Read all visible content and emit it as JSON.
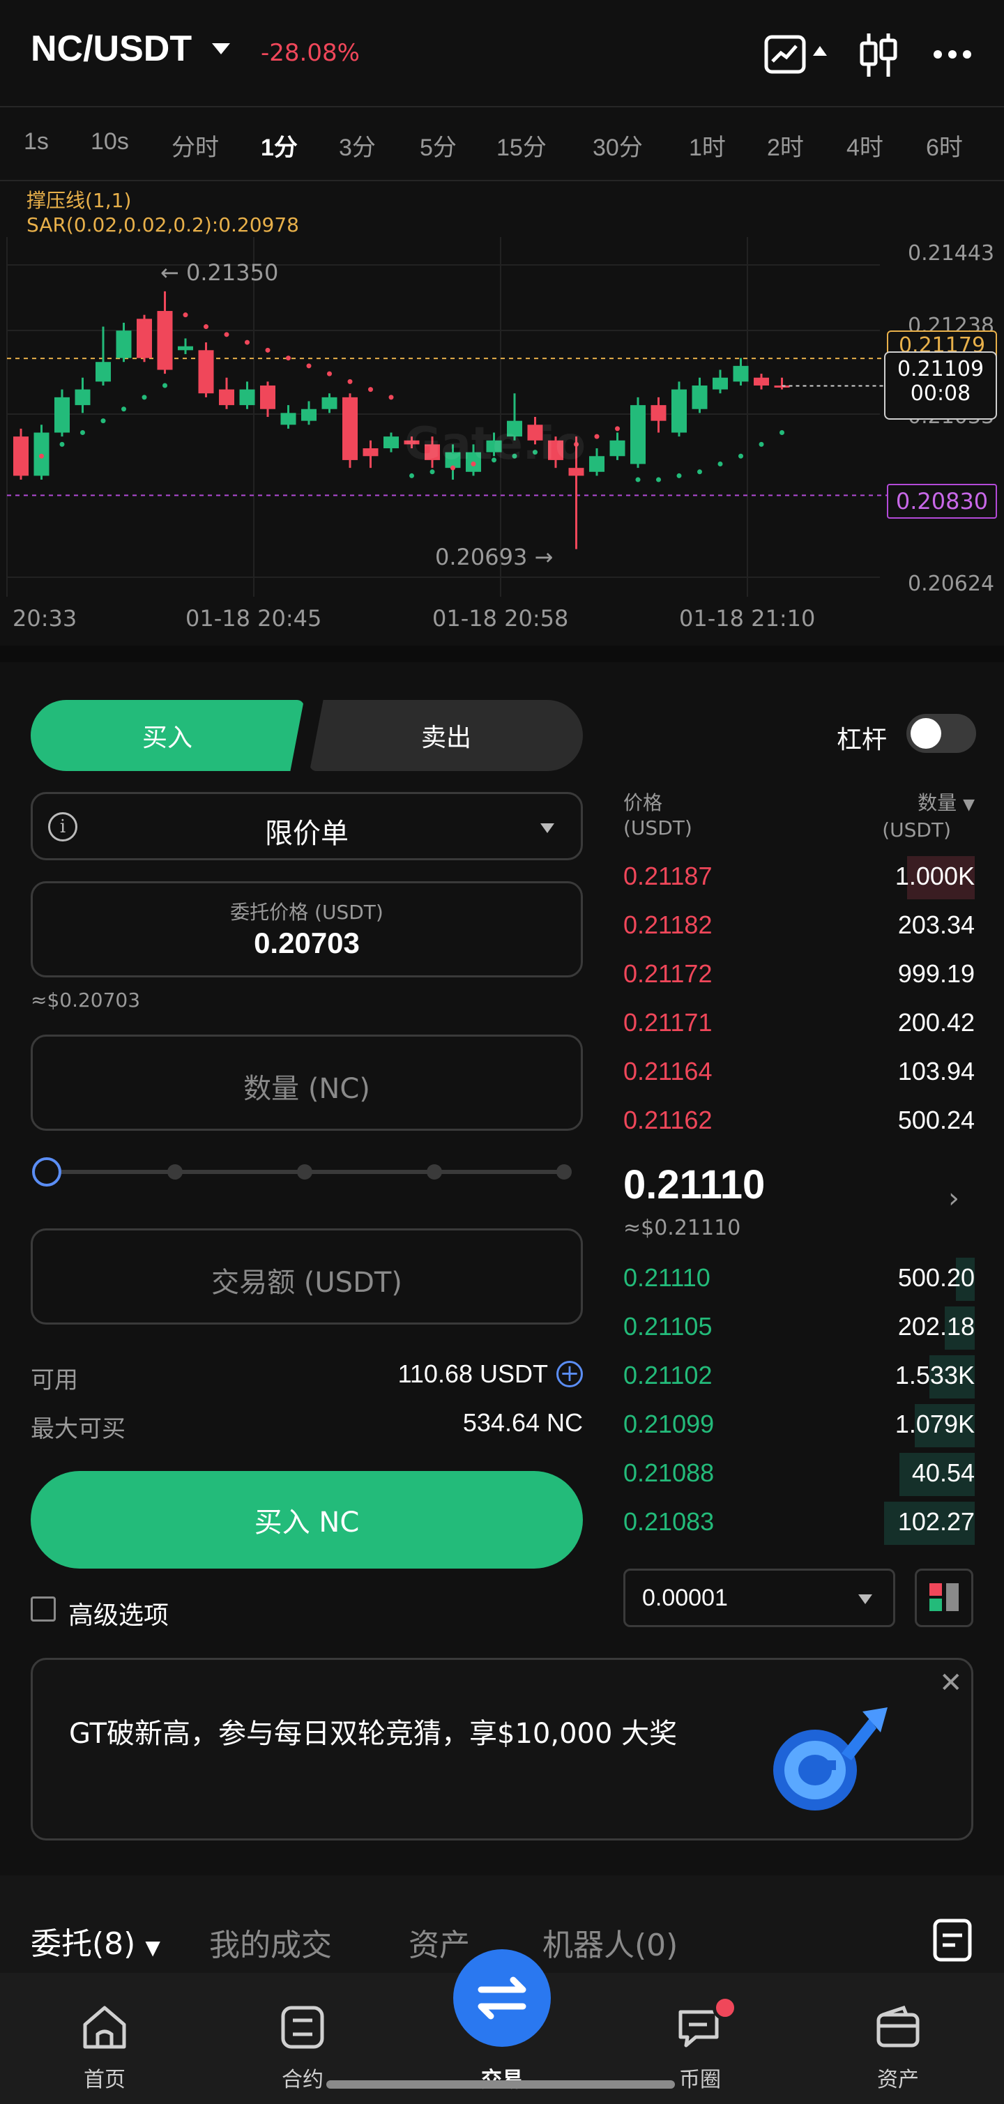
{
  "header": {
    "pair": "NC/USDT",
    "change": "-28.08%",
    "icons": [
      "chart-type-icon",
      "candlestick-settings-icon",
      "more-icon"
    ]
  },
  "timeframes": [
    "1s",
    "10s",
    "分时",
    "1分",
    "3分",
    "5分",
    "15分",
    "30分",
    "1时",
    "2时",
    "4时",
    "6时"
  ],
  "active_timeframe": "1分",
  "indicators": {
    "line1": "撑压线(1,1)",
    "line2": "SAR(0.02,0.02,0.2):0.20978"
  },
  "chart_data": {
    "type": "candlestick",
    "title": "",
    "y_ticks": [
      "0.21443",
      "0.21238",
      "0.21033",
      "0.20624"
    ],
    "y_range": [
      0.206,
      0.2146
    ],
    "x_ticks": [
      "20:33",
      "01-18 20:45",
      "01-18 20:58",
      "01-18 21:10"
    ],
    "high_label": "0.21350",
    "low_label": "0.20693",
    "resistance_label": "0.21179",
    "support_label": "0.20830",
    "resistance": 0.21179,
    "support": 0.2083,
    "last_price_label": "0.21109",
    "countdown": "00:08",
    "last_price": 0.21109,
    "watermark": "Gate.io",
    "candles": [
      {
        "o": 0.2098,
        "c": 0.2088,
        "h": 0.21,
        "l": 0.2087
      },
      {
        "o": 0.2088,
        "c": 0.2099,
        "h": 0.2101,
        "l": 0.2087
      },
      {
        "o": 0.2099,
        "c": 0.2108,
        "h": 0.211,
        "l": 0.2098
      },
      {
        "o": 0.2106,
        "c": 0.211,
        "h": 0.2113,
        "l": 0.2104
      },
      {
        "o": 0.2112,
        "c": 0.2117,
        "h": 0.2126,
        "l": 0.2111
      },
      {
        "o": 0.2118,
        "c": 0.2125,
        "h": 0.2127,
        "l": 0.2117
      },
      {
        "o": 0.2128,
        "c": 0.2118,
        "h": 0.2129,
        "l": 0.2117
      },
      {
        "o": 0.213,
        "c": 0.2115,
        "h": 0.2135,
        "l": 0.2114
      },
      {
        "o": 0.212,
        "c": 0.2121,
        "h": 0.2123,
        "l": 0.2119
      },
      {
        "o": 0.212,
        "c": 0.2109,
        "h": 0.2122,
        "l": 0.2108
      },
      {
        "o": 0.211,
        "c": 0.2106,
        "h": 0.2113,
        "l": 0.2105
      },
      {
        "o": 0.2106,
        "c": 0.211,
        "h": 0.2112,
        "l": 0.2105
      },
      {
        "o": 0.2111,
        "c": 0.2105,
        "h": 0.2112,
        "l": 0.2103
      },
      {
        "o": 0.2101,
        "c": 0.2104,
        "h": 0.2106,
        "l": 0.21
      },
      {
        "o": 0.2102,
        "c": 0.2105,
        "h": 0.2107,
        "l": 0.2101
      },
      {
        "o": 0.2105,
        "c": 0.2108,
        "h": 0.2109,
        "l": 0.2104
      },
      {
        "o": 0.2108,
        "c": 0.2092,
        "h": 0.2109,
        "l": 0.209
      },
      {
        "o": 0.2095,
        "c": 0.2093,
        "h": 0.2097,
        "l": 0.209
      },
      {
        "o": 0.2095,
        "c": 0.2098,
        "h": 0.2099,
        "l": 0.2094
      },
      {
        "o": 0.2097,
        "c": 0.2096,
        "h": 0.2098,
        "l": 0.2095
      },
      {
        "o": 0.2096,
        "c": 0.2092,
        "h": 0.2098,
        "l": 0.209
      },
      {
        "o": 0.209,
        "c": 0.2094,
        "h": 0.2096,
        "l": 0.2087
      },
      {
        "o": 0.2089,
        "c": 0.2094,
        "h": 0.2096,
        "l": 0.2088
      },
      {
        "o": 0.2094,
        "c": 0.2097,
        "h": 0.2099,
        "l": 0.2093
      },
      {
        "o": 0.2098,
        "c": 0.2102,
        "h": 0.2109,
        "l": 0.2097
      },
      {
        "o": 0.2101,
        "c": 0.2097,
        "h": 0.2103,
        "l": 0.2096
      },
      {
        "o": 0.2097,
        "c": 0.2092,
        "h": 0.2098,
        "l": 0.209
      },
      {
        "o": 0.209,
        "c": 0.2088,
        "h": 0.2098,
        "l": 0.20693
      },
      {
        "o": 0.2089,
        "c": 0.2093,
        "h": 0.2095,
        "l": 0.2088
      },
      {
        "o": 0.2093,
        "c": 0.2097,
        "h": 0.2099,
        "l": 0.2092
      },
      {
        "o": 0.2091,
        "c": 0.2106,
        "h": 0.2108,
        "l": 0.209
      },
      {
        "o": 0.2106,
        "c": 0.2102,
        "h": 0.2108,
        "l": 0.2099
      },
      {
        "o": 0.2099,
        "c": 0.211,
        "h": 0.2112,
        "l": 0.2098
      },
      {
        "o": 0.2105,
        "c": 0.2111,
        "h": 0.2113,
        "l": 0.2104
      },
      {
        "o": 0.211,
        "c": 0.2113,
        "h": 0.2115,
        "l": 0.2109
      },
      {
        "o": 0.2112,
        "c": 0.2116,
        "h": 0.2118,
        "l": 0.2111
      },
      {
        "o": 0.2113,
        "c": 0.2111,
        "h": 0.2114,
        "l": 0.211
      },
      {
        "o": 0.2111,
        "c": 0.21109,
        "h": 0.2113,
        "l": 0.211
      }
    ],
    "sar": [
      0.2092,
      0.2093,
      0.2096,
      0.2099,
      0.2102,
      0.2105,
      0.2108,
      0.2111,
      0.2129,
      0.2126,
      0.2124,
      0.2122,
      0.212,
      0.2118,
      0.2116,
      0.2114,
      0.2112,
      0.211,
      0.2108,
      0.2088,
      0.2089,
      0.209,
      0.2091,
      0.2092,
      0.2093,
      0.2094,
      0.2095,
      0.2096,
      0.2098,
      0.21,
      0.2087,
      0.2087,
      0.2088,
      0.2089,
      0.2091,
      0.2093,
      0.2096,
      0.2099
    ],
    "colors": {
      "up": "#23bb7a",
      "down": "#f0475a",
      "sar_up": "#23bb7a",
      "sar_down": "#f0475a"
    }
  },
  "trade": {
    "buy_tab": "买入",
    "sell_tab": "卖出",
    "leverage_label": "杠杆",
    "leverage_on": false,
    "order_type": "限价单",
    "price_label": "委托价格 (USDT)",
    "price_value": "0.20703",
    "price_approx": "≈$0.20703",
    "qty_placeholder": "数量 (NC)",
    "amount_placeholder": "交易额 (USDT)",
    "available_label": "可用",
    "available_value": "110.68 USDT",
    "max_buy_label": "最大可买",
    "max_buy_value": "534.64 NC",
    "buy_button": "买入 NC",
    "advanced_label": "高级选项",
    "slider_percent": 0
  },
  "orderbook": {
    "price_header": "价格",
    "price_unit": "(USDT)",
    "qty_header": "数量",
    "qty_unit": "(USDT)",
    "asks": [
      {
        "price": "0.21187",
        "qty": "1.000K",
        "depth": 0.18
      },
      {
        "price": "0.21182",
        "qty": "203.34",
        "depth": 0.0
      },
      {
        "price": "0.21172",
        "qty": "999.19",
        "depth": 0.0
      },
      {
        "price": "0.21171",
        "qty": "200.42",
        "depth": 0.0
      },
      {
        "price": "0.21164",
        "qty": "103.94",
        "depth": 0.0
      },
      {
        "price": "0.21162",
        "qty": "500.24",
        "depth": 0.0
      }
    ],
    "mid_price": "0.21110",
    "mid_approx": "≈$0.21110",
    "bids": [
      {
        "price": "0.21110",
        "qty": "500.20",
        "depth": 0.05
      },
      {
        "price": "0.21105",
        "qty": "202.18",
        "depth": 0.08
      },
      {
        "price": "0.21102",
        "qty": "1.533K",
        "depth": 0.12
      },
      {
        "price": "0.21099",
        "qty": "1.079K",
        "depth": 0.16
      },
      {
        "price": "0.21088",
        "qty": "40.54",
        "depth": 0.2
      },
      {
        "price": "0.21083",
        "qty": "102.27",
        "depth": 0.24
      }
    ],
    "precision": "0.00001"
  },
  "promo": {
    "text": "GT破新高，参与每日双轮竞猜，享$10,000 大奖"
  },
  "bottom_tabs": {
    "orders": "委托(8)",
    "my_trades": "我的成交",
    "assets": "资产",
    "bots": "机器人(0)"
  },
  "nav": [
    {
      "label": "首页",
      "icon": "home-icon"
    },
    {
      "label": "合约",
      "icon": "futures-icon"
    },
    {
      "label": "交易",
      "icon": "trade-swap-icon"
    },
    {
      "label": "币圈",
      "icon": "community-icon"
    },
    {
      "label": "资产",
      "icon": "wallet-icon"
    }
  ]
}
